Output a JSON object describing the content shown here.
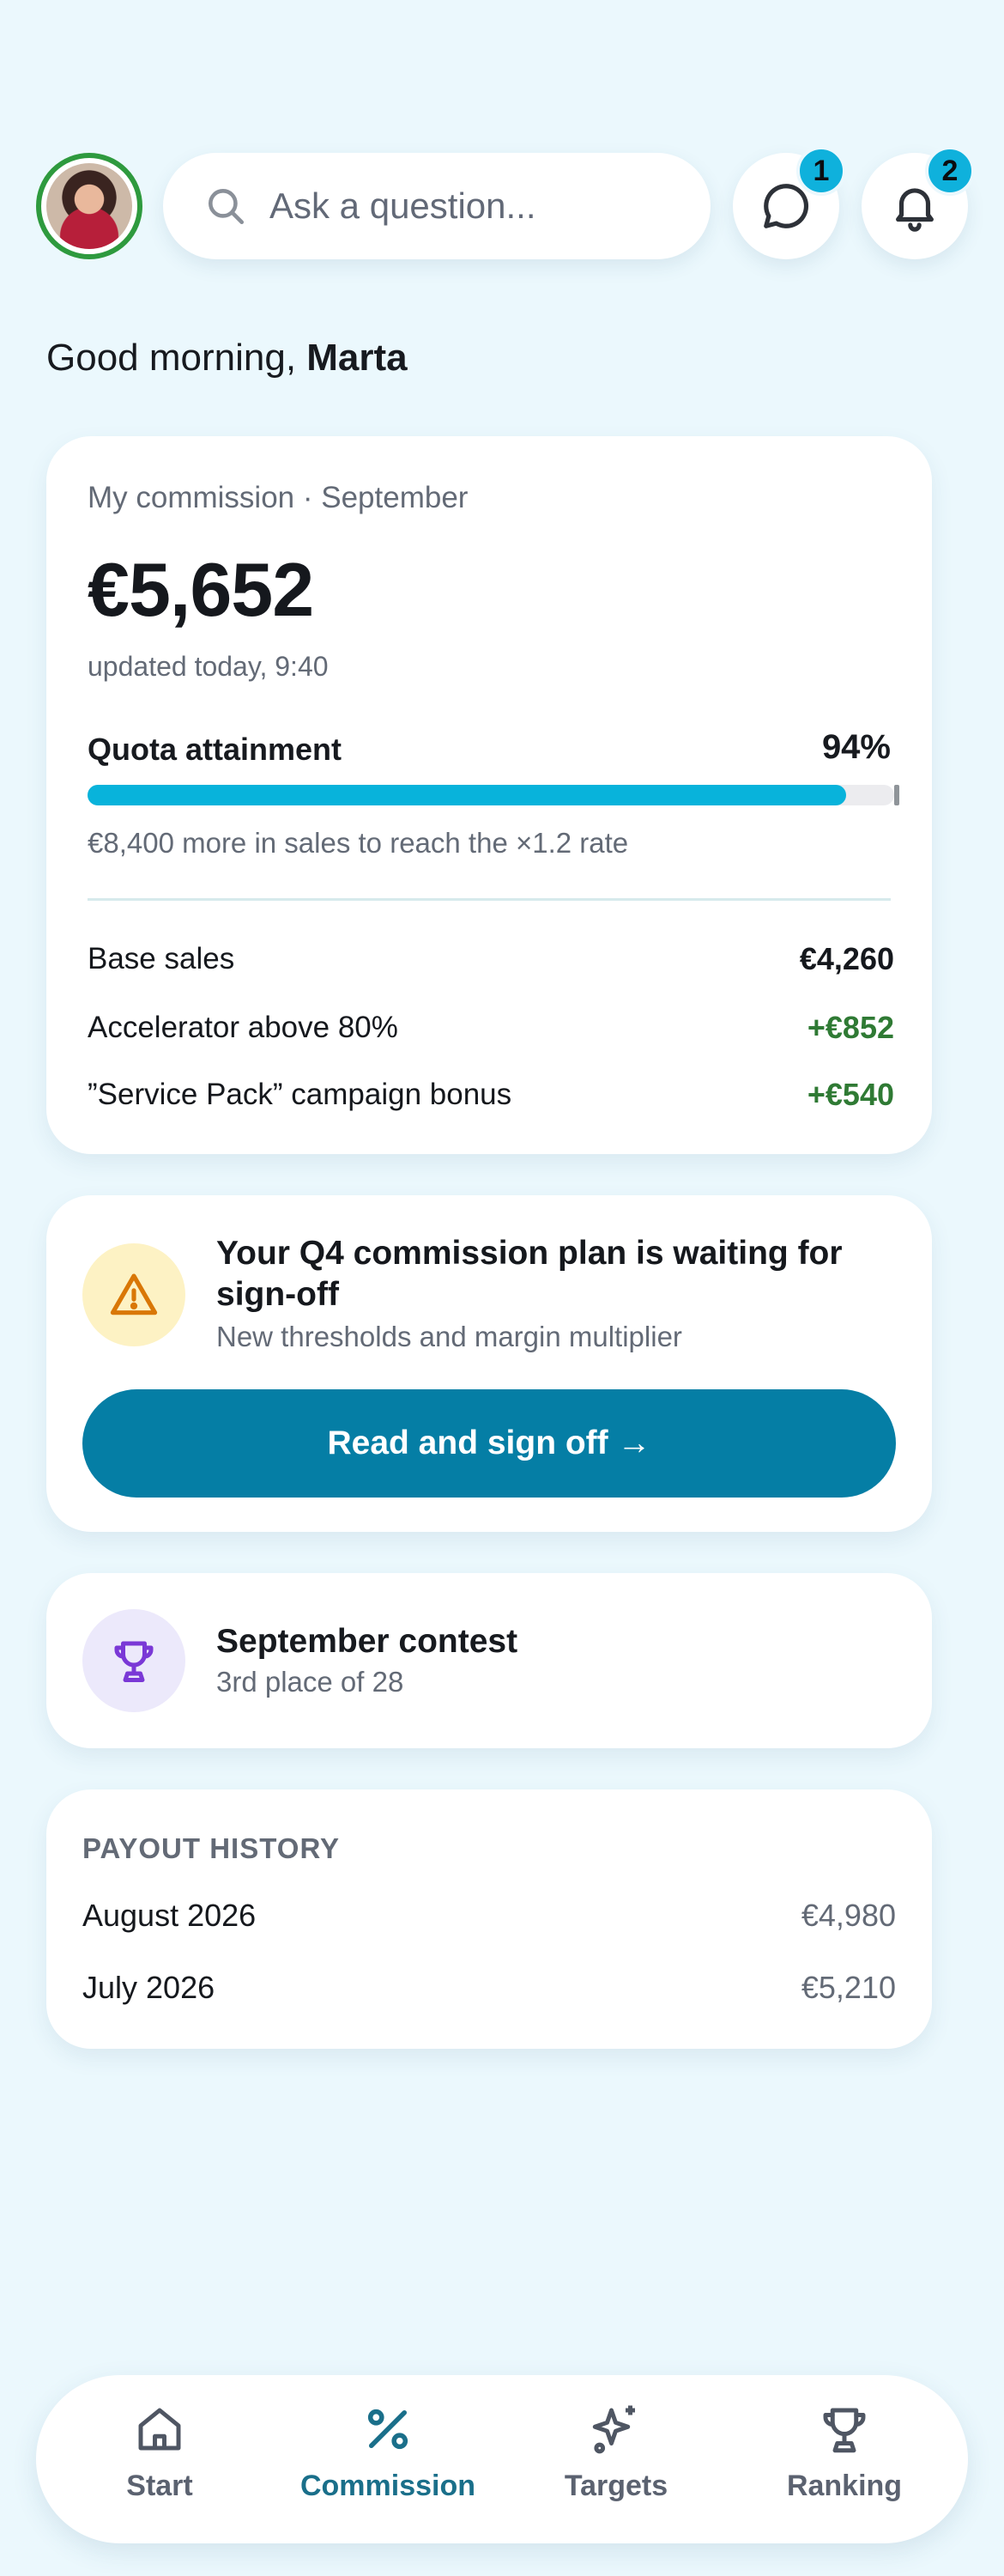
{
  "header": {
    "search_placeholder": "Ask a question...",
    "chat_badge": "1",
    "notifications_badge": "2"
  },
  "greeting": {
    "prefix": "Good morning, ",
    "name": "Marta"
  },
  "commission": {
    "label": "My commission · September",
    "amount": "€5,652",
    "updated": "updated today, 9:40",
    "quota_label": "Quota attainment",
    "quota_percent": "94%",
    "quota_fraction": 0.94,
    "quota_note": "€8,400 more in sales to reach the ×1.2 rate",
    "lines": [
      {
        "label": "Base sales",
        "value": "€4,260"
      },
      {
        "label": "Accelerator above 80%",
        "value": "+€852"
      },
      {
        "label": "”Service Pack” campaign bonus",
        "value": "+€540"
      }
    ]
  },
  "signoff": {
    "title": "Your Q4 commission plan is waiting for sign-off",
    "subtitle": "New thresholds and margin multiplier",
    "button": "Read and sign off →"
  },
  "contest": {
    "title": "September contest",
    "subtitle": "3rd place of 28"
  },
  "payout_history": {
    "heading": "PAYOUT HISTORY",
    "rows": [
      {
        "month": "August 2026",
        "amount": "€4,980"
      },
      {
        "month": "July 2026",
        "amount": "€5,210"
      }
    ]
  },
  "nav": {
    "items": [
      {
        "label": "Start",
        "icon": "home-icon"
      },
      {
        "label": "Commission",
        "icon": "percent-icon",
        "active": true
      },
      {
        "label": "Targets",
        "icon": "sparkles-icon"
      },
      {
        "label": "Ranking",
        "icon": "trophy-icon"
      }
    ]
  },
  "colors": {
    "background": "#ebf8fd",
    "accent": "#08b3db",
    "primary_button": "#057ea5",
    "positive": "#2f7a34",
    "active_nav": "#1a6f8a"
  }
}
